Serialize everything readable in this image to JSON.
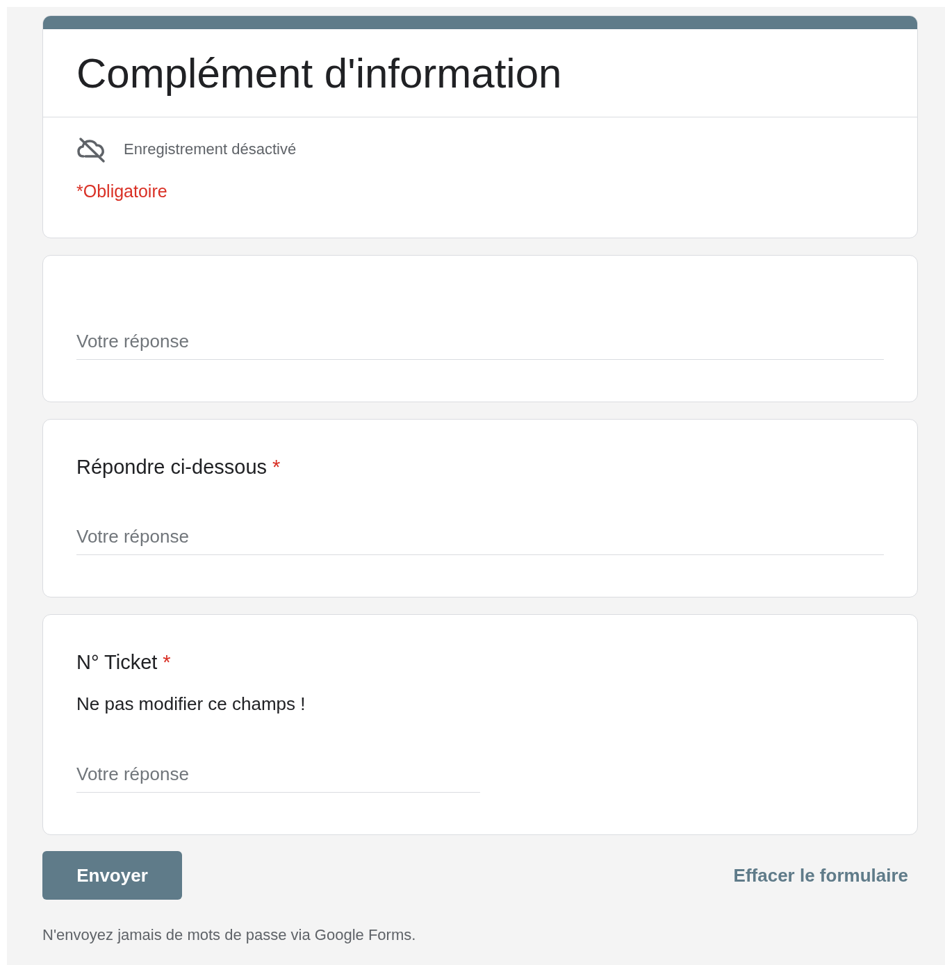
{
  "form": {
    "title": "Complément d'information",
    "saving_notice": "Enregistrement désactivé",
    "required_notice": "*Obligatoire"
  },
  "questions": [
    {
      "placeholder": "Votre réponse",
      "wide": true
    },
    {
      "title": "Répondre ci-dessous",
      "required": true,
      "placeholder": "Votre réponse",
      "wide": true
    },
    {
      "title": "N° Ticket",
      "required": true,
      "description": "Ne pas modifier ce champs !",
      "placeholder": "Votre réponse",
      "wide": false
    }
  ],
  "required_mark": "*",
  "submit_label": "Envoyer",
  "clear_label": "Effacer le formulaire",
  "footer": "N'envoyez jamais de mots de passe via Google Forms."
}
